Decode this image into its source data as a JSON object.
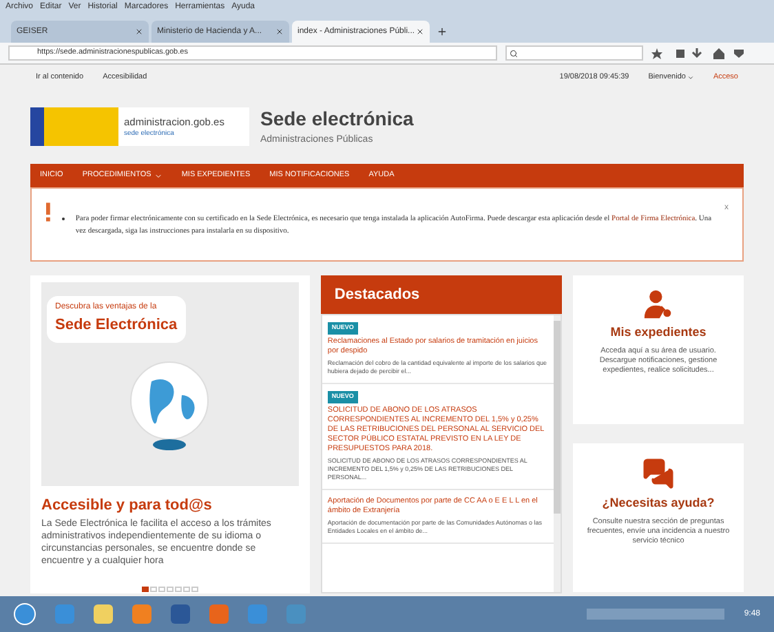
{
  "menu": [
    "Archivo",
    "Editar",
    "Ver",
    "Historial",
    "Marcadores",
    "Herramientas",
    "Ayuda"
  ],
  "tabs": [
    {
      "label": "GEISER",
      "selected": false
    },
    {
      "label": "Ministerio de Hacienda y A...",
      "selected": false
    },
    {
      "label": "index - Administraciones Públi...",
      "selected": true
    }
  ],
  "url": "https://sede.administracionespublicas.gob.es",
  "top_links": [
    "Ir al contenido",
    "Accesibilidad"
  ],
  "datetime": "19/08/2018 09:45:39",
  "user_menu": "Bienvenido",
  "login": "Acceso",
  "logo": {
    "domain": "administracion.gob.es",
    "tagline": "sede electrónica"
  },
  "site_title": "Sede electrónica",
  "site_subtitle": "Administraciones Públicas",
  "nav": [
    {
      "label": "INICIO",
      "kind": "link"
    },
    {
      "label": "PROCEDIMIENTOS",
      "kind": "dropdown"
    },
    {
      "label": "MIS EXPEDIENTES",
      "kind": "link"
    },
    {
      "label": "MIS NOTIFICACIONES",
      "kind": "link"
    },
    {
      "label": "AYUDA",
      "kind": "link"
    }
  ],
  "notice": {
    "text": "Para poder firmar electrónicamente con su certificado en la Sede Electrónica, es necesario que tenga instalada la aplicación AutoFirma. Puede descargar esta aplicación desde el",
    "link": "Portal de Firma Electrónica",
    "after": ". Una vez descargada, siga las instrucciones para instalarla en su dispositivo.",
    "close": "x"
  },
  "banner": {
    "bubble_small": "Descubra las ventajas de la",
    "bubble_big": "Sede Electrónica",
    "title": "Accesible y para tod@s",
    "text": "La Sede Electrónica le facilita el acceso a los trámites administrativos independientemente de su idioma o circunstancias personales, se encuentre donde se encuentre y a cualquier hora",
    "dots": [
      {
        "selected": true
      },
      {
        "selected": false
      },
      {
        "selected": false
      },
      {
        "selected": false
      },
      {
        "selected": false
      },
      {
        "selected": false
      },
      {
        "selected": false
      }
    ]
  },
  "featured": {
    "title": "Destacados",
    "items": [
      {
        "badge": "NUEVO",
        "title": "Reclamaciones al Estado por salarios de tramitación en juicios por despido",
        "summary": "Reclamación del cobro de la cantidad equivalente al importe de los salarios que hubiera dejado de percibir el..."
      },
      {
        "badge": "NUEVO",
        "title": "SOLICITUD DE ABONO DE LOS ATRASOS CORRESPONDIENTES AL INCREMENTO DEL 1,5% y 0,25% DE LAS RETRIBUCIONES DEL PERSONAL AL SERVICIO DEL SECTOR PÚBLICO ESTATAL PREVISTO EN LA LEY DE PRESUPUESTOS PARA 2018.",
        "summary": "SOLICITUD DE ABONO DE LOS ATRASOS CORRESPONDIENTES AL INCREMENTO DEL 1,5% y 0,25% DE LAS RETRIBUCIONES DEL PERSONAL..."
      },
      {
        "title": "Aportación de Documentos por parte de CC AA o E E L L  en el ámbito de Extranjería",
        "summary": "Aportación de documentación por parte de las Comunidades Autónomas o las Entidades Locales en el ámbito de..."
      }
    ]
  },
  "cards": [
    {
      "kind": "user",
      "title": "Mis expedientes",
      "text": "Acceda aquí a su área de usuario. Descargue notificaciones, gestione expedientes, realice solicitudes..."
    },
    {
      "kind": "help",
      "title": "¿Necesitas ayuda?",
      "text": "Consulte nuestra sección de preguntas frecuentes, envíe una incidencia a nuestro servicio técnico"
    }
  ],
  "clock": "9:48"
}
